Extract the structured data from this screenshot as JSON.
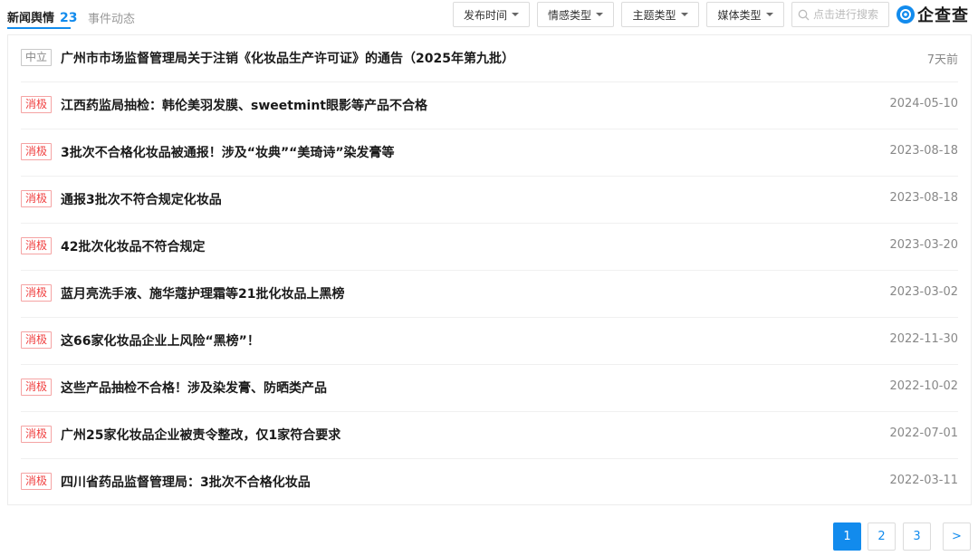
{
  "tabs": {
    "news_label": "新闻舆情",
    "news_count": "23",
    "events_label": "事件动态"
  },
  "filters": [
    {
      "label": "发布时间"
    },
    {
      "label": "情感类型"
    },
    {
      "label": "主题类型"
    },
    {
      "label": "媒体类型"
    }
  ],
  "search": {
    "placeholder": "点击进行搜索"
  },
  "logo": {
    "text": "企查查"
  },
  "news": [
    {
      "sentiment": "中立",
      "kind": "neutral",
      "title": "广州市市场监督管理局关于注销《化妆品生产许可证》的通告（2025年第九批）",
      "date": "7天前"
    },
    {
      "sentiment": "消极",
      "kind": "negative",
      "title": "江西药监局抽检：韩伦美羽发膜、sweetmint眼影等产品不合格",
      "date": "2024-05-10"
    },
    {
      "sentiment": "消极",
      "kind": "negative",
      "title": "3批次不合格化妆品被通报！涉及“妆典”“美琦诗”染发膏等",
      "date": "2023-08-18"
    },
    {
      "sentiment": "消极",
      "kind": "negative",
      "title": "通报3批次不符合规定化妆品",
      "date": "2023-08-18"
    },
    {
      "sentiment": "消极",
      "kind": "negative",
      "title": "42批次化妆品不符合规定",
      "date": "2023-03-20"
    },
    {
      "sentiment": "消极",
      "kind": "negative",
      "title": "蓝月亮洗手液、施华蔻护理霜等21批化妆品上黑榜",
      "date": "2023-03-02"
    },
    {
      "sentiment": "消极",
      "kind": "negative",
      "title": "这66家化妆品企业上风险“黑榜”！",
      "date": "2022-11-30"
    },
    {
      "sentiment": "消极",
      "kind": "negative",
      "title": "这些产品抽检不合格！涉及染发膏、防晒类产品",
      "date": "2022-10-02"
    },
    {
      "sentiment": "消极",
      "kind": "negative",
      "title": "广州25家化妆品企业被责令整改，仅1家符合要求",
      "date": "2022-07-01"
    },
    {
      "sentiment": "消极",
      "kind": "negative",
      "title": "四川省药品监督管理局：3批次不合格化妆品",
      "date": "2022-03-11"
    }
  ],
  "pagination": {
    "pages": [
      "1",
      "2",
      "3"
    ],
    "current": "1",
    "next_label": ">"
  }
}
